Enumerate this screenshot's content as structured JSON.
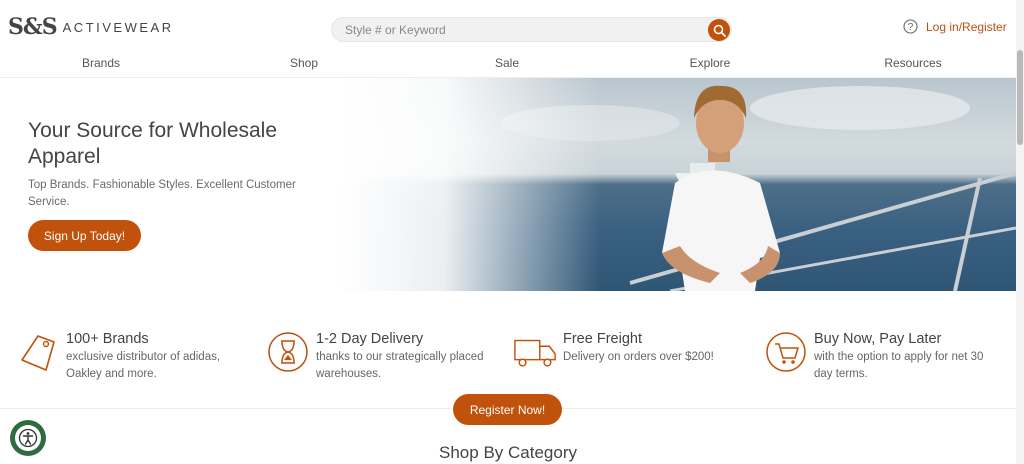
{
  "header": {
    "logo_mark": "S&S",
    "logo_text": "ACTIVEWEAR",
    "search_placeholder": "Style # or Keyword",
    "login_label": "Log in/Register"
  },
  "nav": [
    {
      "label": "Brands"
    },
    {
      "label": "Shop"
    },
    {
      "label": "Sale"
    },
    {
      "label": "Explore"
    },
    {
      "label": "Resources"
    }
  ],
  "hero": {
    "title": "Your Source for Wholesale Apparel",
    "subtitle": "Top Brands. Fashionable Styles. Excellent Customer Service.",
    "cta": "Sign Up Today!"
  },
  "features": [
    {
      "icon": "tag-icon",
      "title": "100+ Brands",
      "desc": "exclusive distributor of adidas, Oakley and more."
    },
    {
      "icon": "hourglass-icon",
      "title": "1-2 Day Delivery",
      "desc": "thanks to our strategically placed warehouses."
    },
    {
      "icon": "truck-icon",
      "title": "Free Freight",
      "desc": "Delivery on orders over $200!"
    },
    {
      "icon": "cart-clock-icon",
      "title": "Buy Now, Pay Later",
      "desc": "with the option to apply for net 30 day terms."
    }
  ],
  "register_cta": "Register Now!",
  "section_title": "Shop By Category",
  "colors": {
    "accent": "#c0520c",
    "text": "#444444",
    "a11y": "#2e6b3f"
  }
}
